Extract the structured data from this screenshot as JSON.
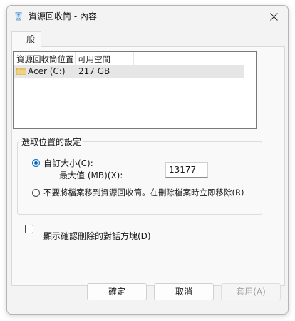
{
  "window": {
    "title": "資源回收筒 - 內容",
    "app_icon": "recycle-bin-icon",
    "close_icon": "close-icon"
  },
  "tabs": [
    {
      "label": "一般",
      "selected": true
    }
  ],
  "list": {
    "columns": [
      "資源回收筒位置",
      "可用空間"
    ],
    "rows": [
      {
        "icon": "folder-icon",
        "name": "Acer (C:)",
        "free_space": "217 GB",
        "selected": true
      }
    ]
  },
  "settings": {
    "group_title": "選取位置的設定",
    "custom_size_label": "自訂大小(C):",
    "custom_size_checked": true,
    "max_value_label": "最大值 (MB)(X):",
    "max_value": "13177",
    "no_move_label": "不要將檔案移到資源回收筒。在刪除檔案時立即移除(R)",
    "no_move_checked": false
  },
  "confirm": {
    "label": "顯示確認刪除的對話方塊(D)",
    "checked": false
  },
  "buttons": {
    "ok": "確定",
    "cancel": "取消",
    "apply": "套用(A)",
    "apply_enabled": false
  },
  "colors": {
    "accent": "#0067c0",
    "selection": "#e6e6e6",
    "disabled_text": "#9d9d9d"
  }
}
